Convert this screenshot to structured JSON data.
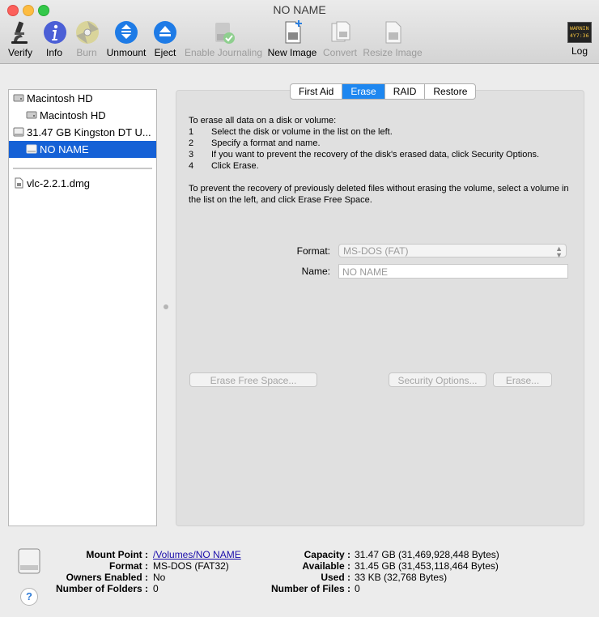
{
  "window": {
    "title": "NO NAME"
  },
  "toolbar": {
    "items": [
      {
        "label": "Verify",
        "icon": "microscope-icon",
        "enabled": true
      },
      {
        "label": "Info",
        "icon": "info-icon",
        "enabled": true
      },
      {
        "label": "Burn",
        "icon": "burn-disc-icon",
        "enabled": false
      },
      {
        "label": "Unmount",
        "icon": "unmount-icon",
        "enabled": true
      },
      {
        "label": "Eject",
        "icon": "eject-icon",
        "enabled": true
      },
      {
        "label": "Enable Journaling",
        "icon": "journaling-icon",
        "enabled": false
      },
      {
        "label": "New Image",
        "icon": "new-image-icon",
        "enabled": true
      },
      {
        "label": "Convert",
        "icon": "convert-icon",
        "enabled": false
      },
      {
        "label": "Resize Image",
        "icon": "resize-image-icon",
        "enabled": false
      }
    ],
    "log": {
      "label": "Log",
      "icon_text": "WARNIN\n4Y7:36",
      "icon": "console-log-icon"
    }
  },
  "sidebar": {
    "items": [
      {
        "label": "Macintosh HD",
        "icon": "hard-drive-icon",
        "selected": false
      },
      {
        "label": "Macintosh HD",
        "icon": "volume-icon",
        "selected": false
      },
      {
        "label": "31.47 GB Kingston DT U...",
        "icon": "usb-drive-icon",
        "selected": false
      },
      {
        "label": "NO NAME",
        "icon": "volume-icon",
        "selected": true
      },
      {
        "label": "vlc-2.2.1.dmg",
        "icon": "dmg-file-icon",
        "selected": false
      }
    ]
  },
  "tabs": [
    {
      "label": "First Aid",
      "active": false
    },
    {
      "label": "Erase",
      "active": true
    },
    {
      "label": "RAID",
      "active": false
    },
    {
      "label": "Restore",
      "active": false
    }
  ],
  "erase": {
    "intro": "To erase all data on a disk or volume:",
    "steps": [
      {
        "num": "1",
        "text": "Select the disk or volume in the list on the left."
      },
      {
        "num": "2",
        "text": "Specify a format and name."
      },
      {
        "num": "3",
        "text": "If you want to prevent the recovery of the disk's erased data, click Security Options."
      },
      {
        "num": "4",
        "text": "Click Erase."
      }
    ],
    "free_space_note": "To prevent the recovery of previously deleted files without erasing the volume, select a volume in the list on the left, and click Erase Free Space.",
    "format_label": "Format:",
    "format_value": "MS-DOS (FAT)",
    "name_label": "Name:",
    "name_placeholder": "NO NAME",
    "buttons": {
      "erase_free_space": "Erase Free Space...",
      "security_options": "Security Options...",
      "erase": "Erase..."
    }
  },
  "info": {
    "left": [
      {
        "label": "Mount Point :",
        "value": "/Volumes/NO NAME",
        "link": true
      },
      {
        "label": "Format :",
        "value": "MS-DOS (FAT32)"
      },
      {
        "label": "Owners Enabled :",
        "value": "No"
      },
      {
        "label": "Number of Folders :",
        "value": "0"
      }
    ],
    "right": [
      {
        "label": "Capacity :",
        "value": "31.47 GB (31,469,928,448 Bytes)"
      },
      {
        "label": "Available :",
        "value": "31.45 GB (31,453,118,464 Bytes)"
      },
      {
        "label": "Used :",
        "value": "33 KB (32,768 Bytes)"
      },
      {
        "label": "Number of Files :",
        "value": "0"
      }
    ],
    "help": "?"
  }
}
